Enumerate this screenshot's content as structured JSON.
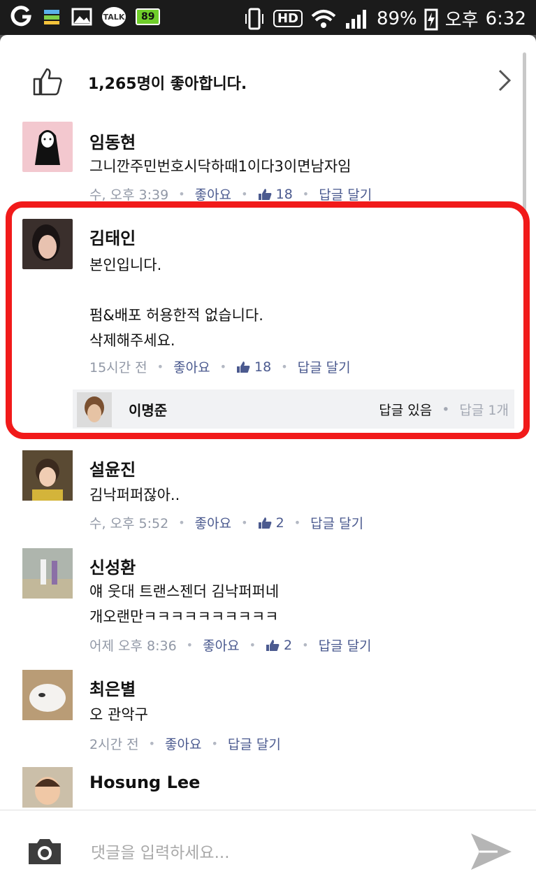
{
  "status": {
    "battery_badge": "89",
    "talk_label": "TALK",
    "hd_label": "HD",
    "battery_percent": "89%",
    "ampm": "오후",
    "time": "6:32"
  },
  "likes": {
    "text": "1,265명이 좋아합니다."
  },
  "comments": [
    {
      "name": "임동현",
      "text": "그니깐주민번호시닥하때1이다3이면남자임",
      "time": "수, 오후 3:39",
      "like": "좋아요",
      "count": "18",
      "reply": "답글 달기"
    },
    {
      "name": "김태인",
      "text": "본인입니다.\n\n펌&배포 허용한적 없습니다.\n삭제해주세요.",
      "time": "15시간 전",
      "like": "좋아요",
      "count": "18",
      "reply": "답글 달기"
    },
    {
      "name": "설윤진",
      "text": "김낙퍼퍼잖아..",
      "time": "수, 오후 5:52",
      "like": "좋아요",
      "count": "2",
      "reply": "답글 달기"
    },
    {
      "name": "신성환",
      "text": "얘 웃대 트랜스젠더 김낙퍼퍼네\n개오랜만ㅋㅋㅋㅋㅋㅋㅋㅋㅋㅋ",
      "time": "어제 오후 8:36",
      "like": "좋아요",
      "count": "2",
      "reply": "답글 달기"
    },
    {
      "name": "최은별",
      "text": "오 관악구",
      "time": "2시간 전",
      "like": "좋아요",
      "reply": "답글 달기"
    },
    {
      "name": "Hosung Lee"
    }
  ],
  "reply_preview": {
    "name": "이명준",
    "status": "답글 있음",
    "count": "답글 1개"
  },
  "input": {
    "placeholder": "댓글을 입력하세요..."
  },
  "colors": {
    "highlight": "#f11a1a",
    "link": "#4b5a8f"
  },
  "icons": [
    "thumbs-up-icon",
    "chevron-right-icon",
    "camera-icon",
    "send-icon"
  ]
}
